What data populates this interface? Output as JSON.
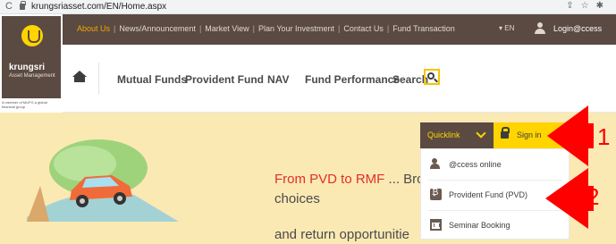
{
  "browser": {
    "url": "krungsriasset.com/EN/Home.aspx"
  },
  "brand": {
    "name": "krungsri",
    "subtitle": "Asset Management",
    "member_note": "A member of MUFG a global financial group"
  },
  "util_links": [
    {
      "label": "About Us",
      "active": true
    },
    {
      "label": "News/Announcement",
      "active": false
    },
    {
      "label": "Market View",
      "active": false
    },
    {
      "label": "Plan Your Investment",
      "active": false
    },
    {
      "label": "Contact Us",
      "active": false
    },
    {
      "label": "Fund Transaction",
      "active": false
    }
  ],
  "util": {
    "lang": "▾ EN",
    "login": "Login@ccess"
  },
  "nav": {
    "mutual_funds": "Mutual Funds",
    "provident_fund": "Provident Fund",
    "nav": "NAV",
    "fund_performance": "Fund Performance",
    "search": "Search"
  },
  "hero": {
    "headline_red": "From PVD to RMF",
    "headline_rest": " ... Bro",
    "line2": "choices",
    "line3": "and return opportunitie"
  },
  "quicklink": {
    "label": "Quicklink",
    "signin": "Sign in",
    "items": [
      {
        "label": "@ccess online",
        "icon": "person-icon"
      },
      {
        "label": "Provident Fund (PVD)",
        "icon": "provident-fund-icon"
      },
      {
        "label": "Seminar Booking",
        "icon": "calendar-icon"
      }
    ]
  },
  "annotations": {
    "one": "1",
    "two": "2"
  },
  "colors": {
    "brand_brown": "#5a4a42",
    "brand_yellow": "#ffd400",
    "active_link": "#f5a300",
    "headline_red": "#e0302a",
    "annotation_red": "#ff0000",
    "hero_bg": "#fbe9b4"
  }
}
